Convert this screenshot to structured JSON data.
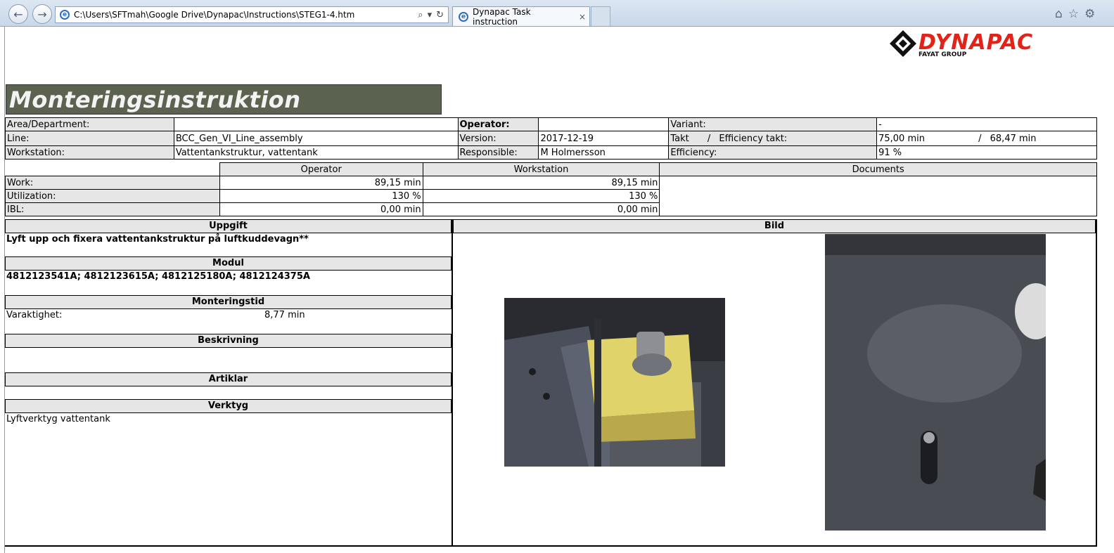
{
  "browser": {
    "address": "C:\\Users\\SFTmah\\Google Drive\\Dynapac\\Instructions\\STEG1-4.htm",
    "tab_title": "Dynapac Task instruction",
    "tab_close": "×",
    "back": "←",
    "forward": "→",
    "search_glyph": "⌕",
    "dropdown_glyph": "▾",
    "refresh_glyph": "↻",
    "home_glyph": "⌂",
    "favorites_glyph": "☆",
    "settings_glyph": "⚙"
  },
  "logo": {
    "word": "DYNAPAC",
    "sub": "FAYAT GROUP",
    "colors": {
      "brand_red": "#e2231a"
    }
  },
  "title": "Monteringsinstruktion",
  "info": {
    "area_label": "Area/Department:",
    "area_value": "",
    "line_label": "Line:",
    "line_value": "BCC_Gen_VI_Line_assembly",
    "ws_label": "Workstation:",
    "ws_value": "Vattentankstruktur, vattentank",
    "operator_label": "Operator:",
    "operator_value": "",
    "version_label": "Version:",
    "version_value": "2017-12-19",
    "responsible_label": "Responsible:",
    "responsible_value": "M Holmersson",
    "variant_label": "Variant:",
    "variant_value": "-",
    "takt_label": "Takt",
    "slash": "/",
    "eff_takt_label": "Efficiency takt:",
    "takt_value": "75,00 min",
    "eff_takt_value": "68,47 min",
    "efficiency_label": "Efficiency:",
    "efficiency_value": "91 %"
  },
  "stats": {
    "headers": {
      "operator": "Operator",
      "workstation": "Workstation",
      "documents": "Documents"
    },
    "rows": [
      {
        "label": "Work:",
        "operator": "89,15 min",
        "workstation": "89,15 min"
      },
      {
        "label": "Utilization:",
        "operator": "130 %",
        "workstation": "130 %"
      },
      {
        "label": "IBL:",
        "operator": "0,00 min",
        "workstation": "0,00 min"
      }
    ]
  },
  "task": {
    "uppgift_header": "Uppgift",
    "uppgift_text": "Lyft upp och fixera vattentankstruktur på luftkuddevagn**",
    "modul_header": "Modul",
    "modul_text": "4812123541A; 4812123615A; 4812125180A; 4812124375A",
    "tid_header": "Monteringstid",
    "varaktighet_label": "Varaktighet:",
    "varaktighet_value": "8,77 min",
    "beskrivning_header": "Beskrivning",
    "beskrivning_text": "",
    "artiklar_header": "Artiklar",
    "artiklar_text": "",
    "verktyg_header": "Verktyg",
    "verktyg_text": "Lyftverktyg vattentank"
  },
  "bild": {
    "header": "Bild"
  }
}
